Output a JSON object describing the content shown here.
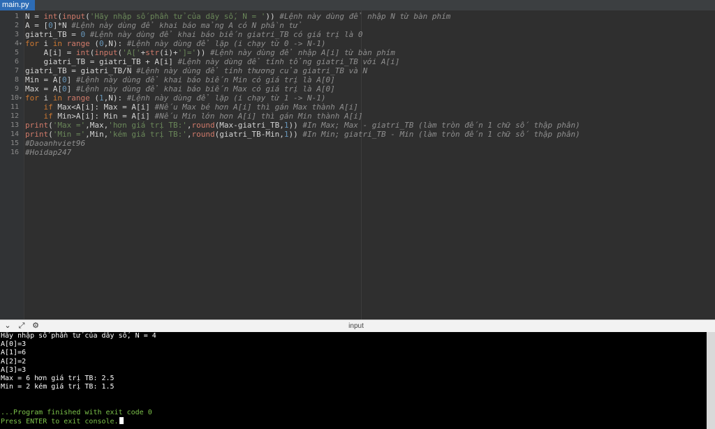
{
  "tab": {
    "label": "main.py"
  },
  "editor": {
    "lines": [
      {
        "n": "1",
        "tokens": [
          [
            "tx",
            "N = "
          ],
          [
            "bi",
            "int"
          ],
          [
            "tx",
            "("
          ],
          [
            "bi",
            "input"
          ],
          [
            "tx",
            "("
          ],
          [
            "st",
            "'Hãy nhập số phần tử của dãy số, N = '"
          ],
          [
            "tx",
            "))"
          ],
          [
            "cm",
            " #Lệnh này dùng để nhập N từ bàn phím"
          ]
        ]
      },
      {
        "n": "2",
        "tokens": [
          [
            "tx",
            "A = ["
          ],
          [
            "nm",
            "0"
          ],
          [
            "tx",
            "]*N"
          ],
          [
            "cm",
            " #Lệnh này dùng để khai báo mảng A có N phần tử"
          ]
        ]
      },
      {
        "n": "3",
        "tokens": [
          [
            "tx",
            "giatri_TB = "
          ],
          [
            "nm",
            "0"
          ],
          [
            "cm",
            " #Lệnh này dùng để khai báo biến giatri_TB có giá trị là 0"
          ]
        ]
      },
      {
        "n": "4",
        "fold": true,
        "tokens": [
          [
            "kw",
            "for"
          ],
          [
            "tx",
            " i "
          ],
          [
            "kw",
            "in"
          ],
          [
            "tx",
            " "
          ],
          [
            "bi",
            "range"
          ],
          [
            "tx",
            " ("
          ],
          [
            "nm",
            "0"
          ],
          [
            "tx",
            ",N):"
          ],
          [
            "cm",
            " #Lệnh này dùng để lặp (i chạy từ 0 -> N-1)"
          ]
        ]
      },
      {
        "n": "5",
        "tokens": [
          [
            "tx",
            "    A[i] = "
          ],
          [
            "bi",
            "int"
          ],
          [
            "tx",
            "("
          ],
          [
            "bi",
            "input"
          ],
          [
            "tx",
            "("
          ],
          [
            "st",
            "'A['"
          ],
          [
            "tx",
            "+"
          ],
          [
            "bi",
            "str"
          ],
          [
            "tx",
            "(i)+"
          ],
          [
            "st",
            "']='"
          ],
          [
            "tx",
            "))"
          ],
          [
            "cm",
            " #Lệnh này dùng để nhập A[i] từ bàn phím"
          ]
        ]
      },
      {
        "n": "6",
        "tokens": [
          [
            "tx",
            "    giatri_TB = giatri_TB + A[i]"
          ],
          [
            "cm",
            " #Lệnh này dùng để tính tổng giatri_TB với A[i]"
          ]
        ]
      },
      {
        "n": "7",
        "tokens": [
          [
            "tx",
            "giatri_TB = giatri_TB/N"
          ],
          [
            "cm",
            " #Lệnh này dùng để tính thương của giatri_TB và N"
          ]
        ]
      },
      {
        "n": "8",
        "tokens": [
          [
            "tx",
            "Min = A["
          ],
          [
            "nm",
            "0"
          ],
          [
            "tx",
            "]"
          ],
          [
            "cm",
            " #Lệnh này dùng để khai báo biến Min có giá trị là A[0]"
          ]
        ]
      },
      {
        "n": "9",
        "tokens": [
          [
            "tx",
            "Max = A["
          ],
          [
            "nm",
            "0"
          ],
          [
            "tx",
            "]"
          ],
          [
            "cm",
            " #Lệnh này dùng để khai báo biến Max có giá trị là A[0]"
          ]
        ]
      },
      {
        "n": "10",
        "fold": true,
        "tokens": [
          [
            "kw",
            "for"
          ],
          [
            "tx",
            " i "
          ],
          [
            "kw",
            "in"
          ],
          [
            "tx",
            " "
          ],
          [
            "bi",
            "range"
          ],
          [
            "tx",
            " ("
          ],
          [
            "nm",
            "1"
          ],
          [
            "tx",
            ",N):"
          ],
          [
            "cm",
            " #Lệnh này dùng để lặp (i chạy từ 1 -> N-1)"
          ]
        ]
      },
      {
        "n": "11",
        "tokens": [
          [
            "tx",
            "    "
          ],
          [
            "kw",
            "if"
          ],
          [
            "tx",
            " Max<A[i]: Max = A[i]"
          ],
          [
            "cm",
            " #Nếu Max bé hơn A[i] thì gán Max thành A[i]"
          ]
        ]
      },
      {
        "n": "12",
        "tokens": [
          [
            "tx",
            "    "
          ],
          [
            "kw",
            "if"
          ],
          [
            "tx",
            " Min>A[i]: Min = A[i]"
          ],
          [
            "cm",
            " #Nếu Min lớn hơn A[i] thì gán Min thành A[i]"
          ]
        ]
      },
      {
        "n": "13",
        "tokens": [
          [
            "bi",
            "print"
          ],
          [
            "tx",
            "("
          ],
          [
            "st",
            "'Max ='"
          ],
          [
            "tx",
            ",Max,"
          ],
          [
            "st",
            "'hơn giá trị TB:'"
          ],
          [
            "tx",
            ","
          ],
          [
            "bi",
            "round"
          ],
          [
            "tx",
            "(Max-giatri_TB,"
          ],
          [
            "nm",
            "1"
          ],
          [
            "tx",
            "))"
          ],
          [
            "cm",
            " #In Max; Max - giatri_TB (làm tròn đến 1 chữ số thập phân)"
          ]
        ]
      },
      {
        "n": "14",
        "tokens": [
          [
            "bi",
            "print"
          ],
          [
            "tx",
            "("
          ],
          [
            "st",
            "'Min ='"
          ],
          [
            "tx",
            ",Min,"
          ],
          [
            "st",
            "'kém giá trị TB:'"
          ],
          [
            "tx",
            ","
          ],
          [
            "bi",
            "round"
          ],
          [
            "tx",
            "(giatri_TB-Min,"
          ],
          [
            "nm",
            "1"
          ],
          [
            "tx",
            "))"
          ],
          [
            "cm",
            " #In Min; giatri_TB - Min (làm tròn đến 1 chữ số thập phân)"
          ]
        ]
      },
      {
        "n": "15",
        "tokens": [
          [
            "cm",
            "#Daoanhviet96"
          ]
        ]
      },
      {
        "n": "16",
        "tokens": [
          [
            "cm",
            "#Hoidap247"
          ]
        ]
      }
    ]
  },
  "console_header": {
    "title": "input",
    "icons": [
      "chevron-down-icon",
      "expand-icon",
      "settings-icon"
    ]
  },
  "console": {
    "lines": [
      {
        "text": "Hãy nhập số phần tử của dãy số, N = 4",
        "color": "white"
      },
      {
        "text": "A[0]=3",
        "color": "white"
      },
      {
        "text": "A[1]=6",
        "color": "white"
      },
      {
        "text": "A[2]=2",
        "color": "white"
      },
      {
        "text": "A[3]=3",
        "color": "white"
      },
      {
        "text": "Max = 6 hơn giá trị TB: 2.5",
        "color": "white"
      },
      {
        "text": "Min = 2 kém giá trị TB: 1.5",
        "color": "white"
      },
      {
        "text": "",
        "color": "white"
      },
      {
        "text": "",
        "color": "white"
      },
      {
        "text": "...Program finished with exit code 0",
        "color": "green"
      },
      {
        "text": "Press ENTER to exit console.",
        "color": "green",
        "cursor": true
      }
    ]
  }
}
